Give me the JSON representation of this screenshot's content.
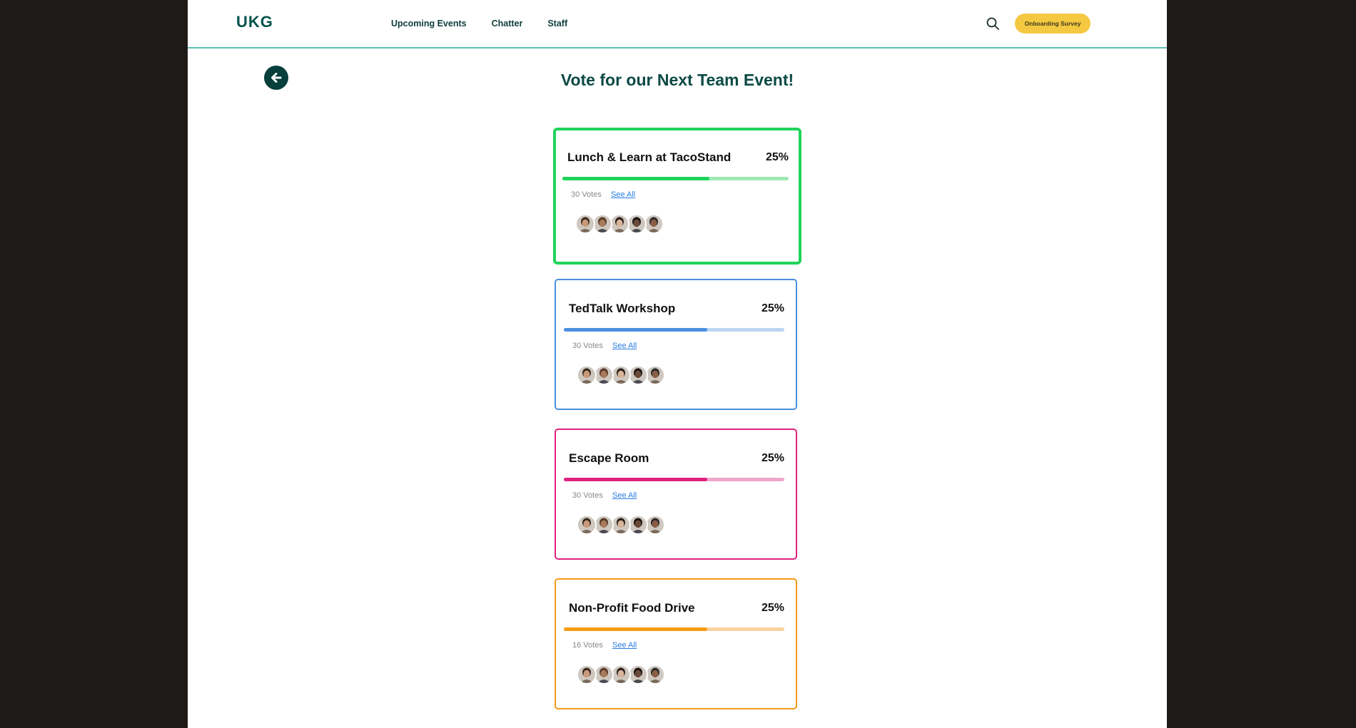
{
  "header": {
    "logo": "UKG",
    "nav": [
      "Upcoming Events",
      "Chatter",
      "Staff"
    ],
    "survey_button": "Onboarding Survey"
  },
  "main": {
    "title": "Vote for our Next Team Event!",
    "see_all_label": "See All",
    "options": [
      {
        "name": "Lunch & Learn at TacoStand",
        "percent": "25%",
        "votes": "30 Votes",
        "progress": 0.65,
        "color": "#1fd35a",
        "track": "#9de9b4",
        "selected": true
      },
      {
        "name": "TedTalk Workshop",
        "percent": "25%",
        "votes": "30 Votes",
        "progress": 0.65,
        "color": "#4a8fe0",
        "track": "#bcd4f4",
        "selected": false
      },
      {
        "name": "Escape Room",
        "percent": "25%",
        "votes": "30 Votes",
        "progress": 0.65,
        "color": "#e0217f",
        "track": "#f0a6ca",
        "selected": false
      },
      {
        "name": "Non-Profit Food Drive",
        "percent": "25%",
        "votes": "16 Votes",
        "progress": 0.65,
        "color": "#f59a14",
        "track": "#f9d3a0",
        "selected": false
      }
    ]
  },
  "colors": {
    "accent": "#00534c",
    "header_border": "#5fbfb4",
    "survey_button": "#f5c842"
  },
  "icons": [
    "search-icon",
    "back-arrow-icon",
    "avatar"
  ]
}
